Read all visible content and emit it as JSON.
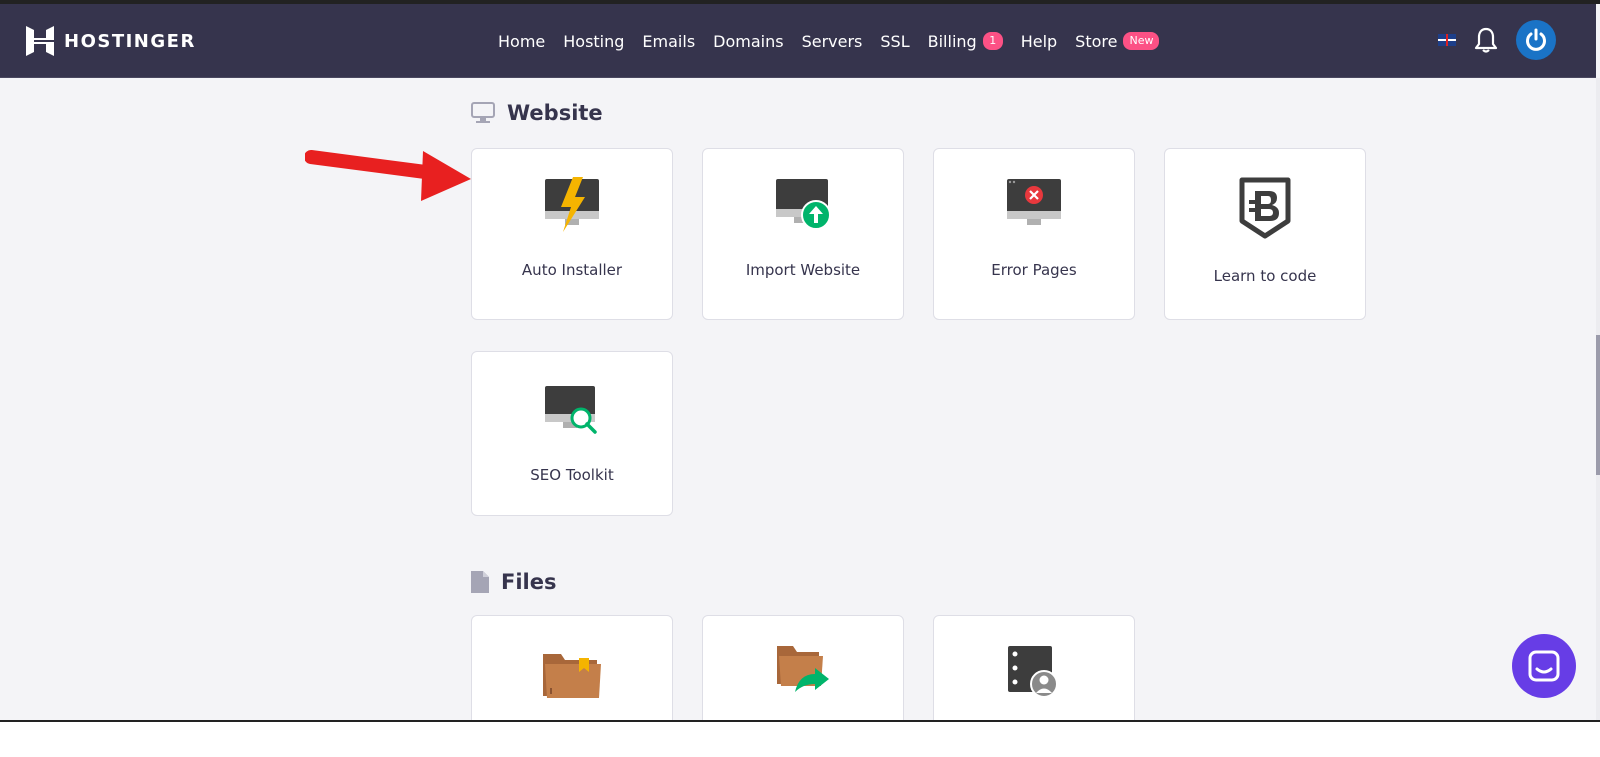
{
  "brand": {
    "name": "HOSTINGER"
  },
  "nav": {
    "items": [
      {
        "label": "Home"
      },
      {
        "label": "Hosting"
      },
      {
        "label": "Emails"
      },
      {
        "label": "Domains"
      },
      {
        "label": "Servers"
      },
      {
        "label": "SSL"
      },
      {
        "label": "Billing",
        "badge": "1"
      },
      {
        "label": "Help"
      },
      {
        "label": "Store",
        "badge": "New"
      }
    ]
  },
  "header_icons": [
    "flag-uk-icon",
    "bell-icon",
    "power-avatar-icon"
  ],
  "website_section": {
    "title": "Website",
    "icon": "monitor-icon",
    "cards": [
      {
        "label": "Auto Installer",
        "icon": "monitor-lightning-icon"
      },
      {
        "label": "Import Website",
        "icon": "monitor-upload-icon"
      },
      {
        "label": "Error Pages",
        "icon": "monitor-error-icon"
      },
      {
        "label": "Learn to code",
        "icon": "b-shield-icon"
      },
      {
        "label": "SEO Toolkit",
        "icon": "monitor-search-icon"
      }
    ]
  },
  "files_section": {
    "title": "Files",
    "icon": "file-icon",
    "cards": [
      {
        "label": "",
        "icon": "folder-bookmark-icon"
      },
      {
        "label": "",
        "icon": "folder-share-icon"
      },
      {
        "label": "",
        "icon": "server-user-icon"
      }
    ]
  },
  "annotation": {
    "icon": "red-arrow-icon"
  },
  "chat": {
    "icon": "chat-icon"
  },
  "colors": {
    "navbar": "#36344d",
    "accent": "#673de6",
    "badge": "#fc5185",
    "page_bg": "#f4f4f7"
  }
}
